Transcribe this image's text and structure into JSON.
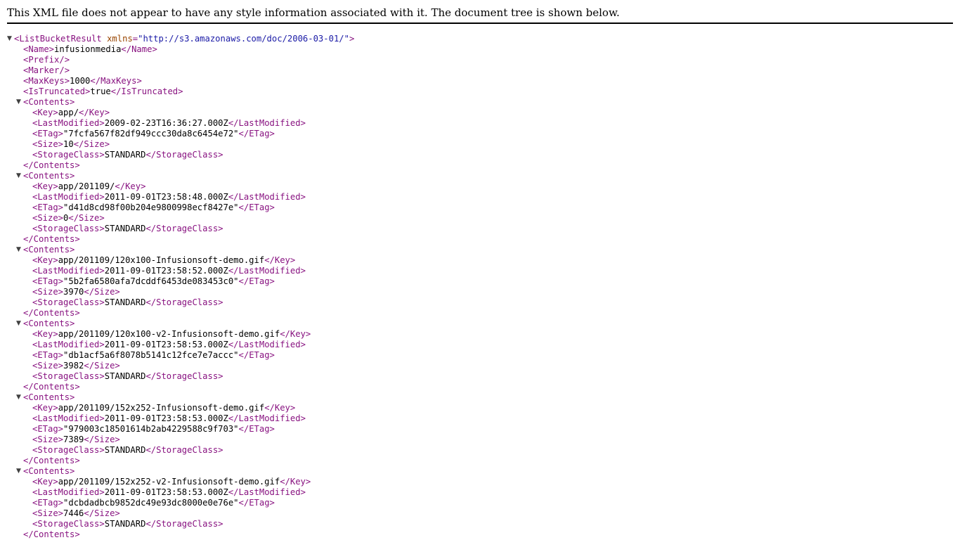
{
  "header": {
    "message": "This XML file does not appear to have any style information associated with it. The document tree is shown below."
  },
  "root": {
    "tag": "ListBucketResult",
    "attr_name": "xmlns",
    "attr_value": "\"http://s3.amazonaws.com/doc/2006-03-01/\""
  },
  "bucket": {
    "name": "infusionmedia",
    "max_keys": "1000",
    "is_truncated": "true"
  },
  "contents": [
    {
      "key": "app/",
      "last_modified": "2009-02-23T16:36:27.000Z",
      "etag": "\"7fcfa567f82df949ccc30da8c6454e72\"",
      "size": "10",
      "storage_class": "STANDARD"
    },
    {
      "key": "app/201109/",
      "last_modified": "2011-09-01T23:58:48.000Z",
      "etag": "\"d41d8cd98f00b204e9800998ecf8427e\"",
      "size": "0",
      "storage_class": "STANDARD"
    },
    {
      "key": "app/201109/120x100-Infusionsoft-demo.gif",
      "last_modified": "2011-09-01T23:58:52.000Z",
      "etag": "\"5b2fa6580afa7dcddf6453de083453c0\"",
      "size": "3970",
      "storage_class": "STANDARD"
    },
    {
      "key": "app/201109/120x100-v2-Infusionsoft-demo.gif",
      "last_modified": "2011-09-01T23:58:53.000Z",
      "etag": "\"db1acf5a6f8078b5141c12fce7e7accc\"",
      "size": "3982",
      "storage_class": "STANDARD"
    },
    {
      "key": "app/201109/152x252-Infusionsoft-demo.gif",
      "last_modified": "2011-09-01T23:58:53.000Z",
      "etag": "\"979003c18501614b2ab4229588c9f703\"",
      "size": "7389",
      "storage_class": "STANDARD"
    },
    {
      "key": "app/201109/152x252-v2-Infusionsoft-demo.gif",
      "last_modified": "2011-09-01T23:58:53.000Z",
      "etag": "\"dcbdadbcb9852dc49e93dc8000e0e76e\"",
      "size": "7446",
      "storage_class": "STANDARD"
    }
  ],
  "icons": {
    "expanded": "▼"
  },
  "colors": {
    "tag": "#881280",
    "attribute_name": "#994500",
    "attribute_value": "#1a1aa6",
    "text": "#000000"
  }
}
